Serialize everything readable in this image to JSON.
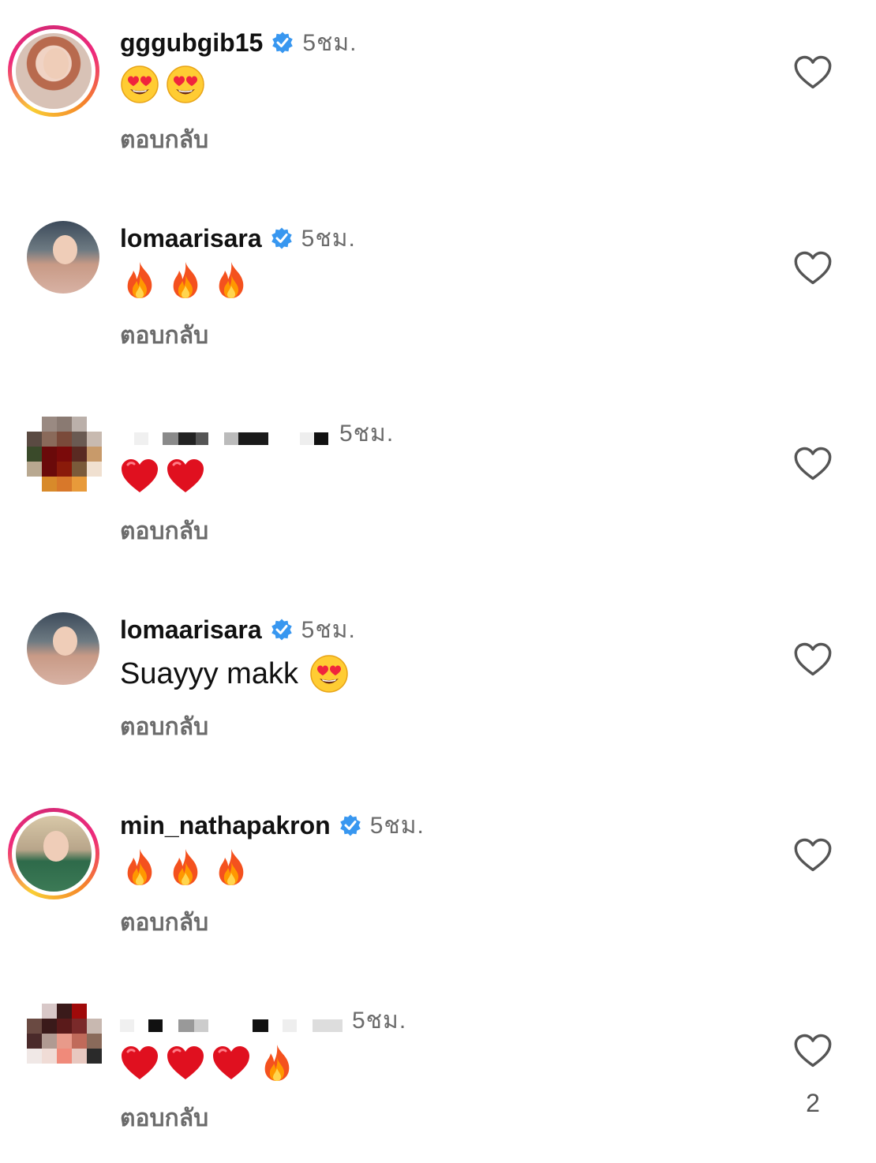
{
  "comments": [
    {
      "username": "gggubgib15",
      "verified": true,
      "time": "5ชม.",
      "text": "",
      "emojis": [
        "heart-eyes",
        "heart-eyes"
      ],
      "reply_label": "ตอบกลับ",
      "avatar": "story-ring",
      "likes": ""
    },
    {
      "username": "lomaarisara",
      "verified": true,
      "time": "5ชม.",
      "text": "",
      "emojis": [
        "fire",
        "fire",
        "fire"
      ],
      "reply_label": "ตอบกลับ",
      "avatar": "plain",
      "likes": ""
    },
    {
      "username": "",
      "verified": false,
      "time": "5ชม.",
      "text": "",
      "emojis": [
        "red-heart",
        "red-heart"
      ],
      "reply_label": "ตอบกลับ",
      "avatar": "pixelated",
      "likes": ""
    },
    {
      "username": "lomaarisara",
      "verified": true,
      "time": "5ชม.",
      "text": "Suayyy makk",
      "emojis": [
        "heart-eyes"
      ],
      "reply_label": "ตอบกลับ",
      "avatar": "plain",
      "likes": ""
    },
    {
      "username": "min_nathapakron",
      "verified": true,
      "time": "5ชม.",
      "text": "",
      "emojis": [
        "fire",
        "fire",
        "fire"
      ],
      "reply_label": "ตอบกลับ",
      "avatar": "story-ring",
      "likes": ""
    },
    {
      "username": "",
      "verified": false,
      "time": "5ชม.",
      "text": "",
      "emojis": [
        "red-heart",
        "red-heart",
        "red-heart",
        "fire"
      ],
      "reply_label": "ตอบกลับ",
      "avatar": "pixelated",
      "likes": "2"
    }
  ],
  "colors": {
    "verified_blue": "#3897f0",
    "secondary_text": "#6b6b6b",
    "heart_outline": "#555555"
  }
}
